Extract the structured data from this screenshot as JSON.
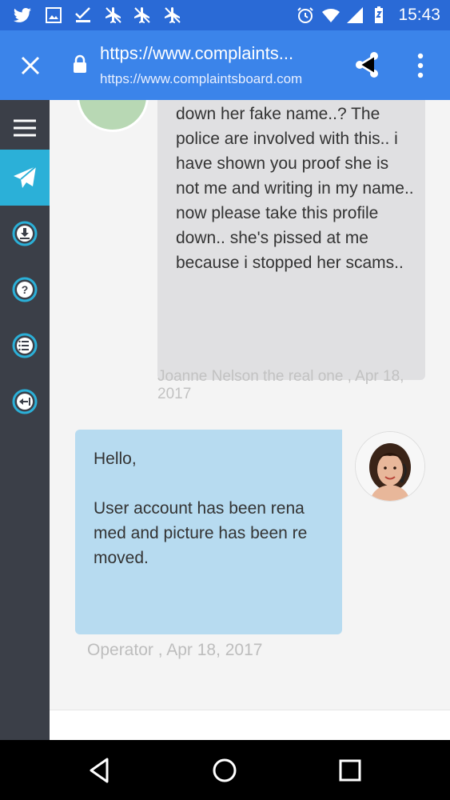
{
  "status_bar": {
    "time": "15:43",
    "left_icons": [
      "twitter-icon",
      "gallery-icon",
      "check-double-icon",
      "plane-off-icon",
      "plane-off-icon",
      "plane-off-icon"
    ],
    "right_icons": [
      "alarm-icon",
      "wifi-icon",
      "signal-icon",
      "battery-icon"
    ]
  },
  "browser": {
    "title": "https://www.complaints...",
    "url": "https://www.complaintsboard.com"
  },
  "sidebar": {
    "items": [
      {
        "name": "menu-icon",
        "active": false
      },
      {
        "name": "send-icon",
        "active": true
      },
      {
        "name": "download-icon",
        "active": false
      },
      {
        "name": "help-icon",
        "active": false
      },
      {
        "name": "list-icon",
        "active": false
      },
      {
        "name": "back-icon",
        "active": false
      }
    ]
  },
  "messages": [
    {
      "text": "down her fake name..? The police are involved with this.. i have shown you proof she is not me and writing in my name.. now please take this profile down.. she's pissed at me because i stopped her scams..",
      "meta": "Joanne Nelson the real one , Apr 18, 2017"
    },
    {
      "greeting": "Hello,",
      "text": "User account has been rena med and picture has been re moved.",
      "meta": "Operator , Apr 18, 2017"
    }
  ],
  "colors": {
    "status_bar": "#2a6ad6",
    "browser_bar": "#3b84ea",
    "sidebar": "#3b3f48",
    "sidebar_active": "#2bb0d8",
    "user_bubble": "#e0e0e2",
    "operator_bubble": "#b7dbf0"
  }
}
